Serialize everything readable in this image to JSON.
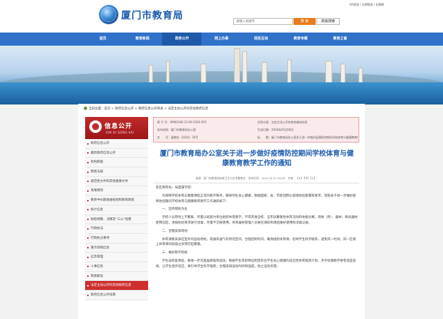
{
  "header": {
    "site_title": "厦门市教育局",
    "top_links": "OA登录 | 长期登录 | 无障碍",
    "search_placeholder": "请输入关键字",
    "search_button": "搜 索",
    "advanced_search": "高级搜索"
  },
  "nav": {
    "items": [
      "首页",
      "教育新闻",
      "政务公开",
      "网上办事",
      "政民互动",
      "教育专题",
      "教育之窗"
    ],
    "active_index": 2
  },
  "breadcrumb": "当前位置：首页 > 政府信息公开 > 政府信息公开目录 > 法定主动公开的其他政府信息",
  "sidebar": {
    "banner_title": "信息公开",
    "banner_sub": "XIN XI GONG KAI",
    "items": [
      "政府信息公开",
      "最新政府信息公开",
      "机构职能",
      "政策法规",
      "规范性文件和其他重要文件",
      "发展规划",
      "教育中长期发展规划和教育政策",
      "统计信息",
      "财政预算、决算及“三公”经费",
      "行政执法",
      "行政执法事项",
      "重点领域信息",
      "应急管理",
      "人事信息",
      "政策解读",
      "法定主动公开的其他政府信息",
      "政府信息公开指南"
    ],
    "active_index": 15
  },
  "info_box": {
    "index_no": "索 引 号：XM00106-12-00-2020-025",
    "category": "信息分类：法定主动公开的其他政府信息",
    "publisher": "发布机构：厦门市教育局办公室",
    "date": "生成日期：2020年05月08日",
    "doc_no": "文　　号：厦教办〔2020〕30号",
    "title_field": "标　　题：厦门市教育局办公室关于进一步做好疫情防控期间学校体育与健康教育教学工作的通知"
  },
  "document": {
    "title": "厦门市教育局办公室关于进一步做好疫情防控期间学校体育与健康教育教学工作的通知",
    "meta": "来源：厦门市教育局体育卫生与艺术教育处　发布时间：2020-05-07 09:09　字体：【大】【中】【小】",
    "salutation": "各区教育局，局直属学校：",
    "para1": "为保障学校体育与健康课程正常的教学秩序，确保师生身心健康，根据国家、省、市新冠肺炎疫情防控部署和要求，现就关于进一步做好疫情防控期间学校体育与健康教育教学工作通知如下：",
    "sec1": "一、坚持预防为主",
    "para2": "学校人员原则上不聚集，尽量以班级为单位组织体育教学，不得开展全校、全年段聚集性体育活动和体能比赛，场地（所）、器材、教具器材使用前后，须按防控要求进行消毒，尽量不交换使用。体育器材管理人员要在课前和课后做好使用和消毒记录。",
    "sec2": "二、合理安排场地",
    "para3": "体育课要安排在室外的运动场地，或通风通气的场馆空间，合理控制时间，确保组织体育课，指导学生科学锻炼，避免同一时间，同一区域上体育课的班级过多而引起聚集。",
    "sec3": "三、做好教学衔接",
    "para4": "学生返校复课后，要进一步巩固居家锻炼成效，根据学生年龄特征制定符合学生身心健康的适应性体育锻炼计划，开学初期教学要有适度安排，让学生逐步适应，要引导学生科学锻炼，合理安排运动时间和强度，防止运动伤害。"
  }
}
